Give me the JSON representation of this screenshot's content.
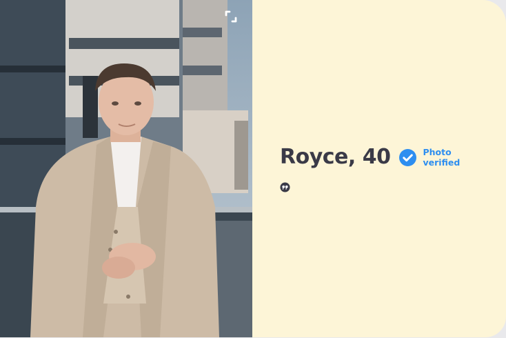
{
  "profile": {
    "name_age": "Royce, 40",
    "verified_line1": "Photo",
    "verified_line2": "verified"
  },
  "icons": {
    "expand": "expand-icon",
    "verified": "verified-check-icon",
    "quote": "quote-icon"
  },
  "colors": {
    "card_background": "#fdf5d7",
    "name_text": "#3a3a47",
    "verified_blue": "#2d8ef0"
  }
}
